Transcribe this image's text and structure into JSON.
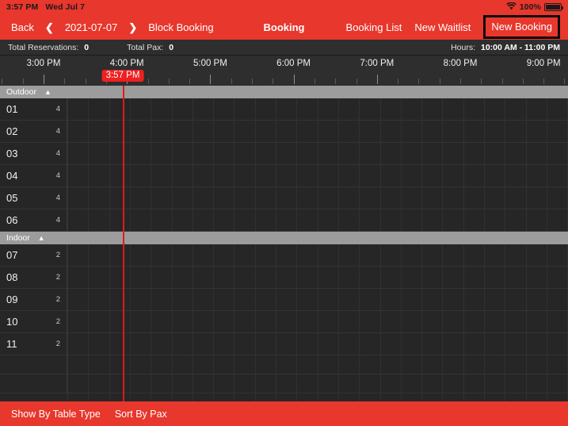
{
  "status_bar": {
    "time": "3:57 PM",
    "date": "Wed Jul 7",
    "battery_percent": "100%",
    "wifi_icon": "wifi-icon",
    "battery_icon": "battery-icon"
  },
  "navbar": {
    "back_label": "Back",
    "prev_icon": "chevron-left-icon",
    "date_label": "2021-07-07",
    "next_icon": "chevron-right-icon",
    "block_booking_label": "Block Booking",
    "title": "Booking",
    "booking_list_label": "Booking List",
    "new_waitlist_label": "New Waitlist",
    "new_booking_label": "New Booking",
    "accent_color": "#e8372c",
    "highlight_border_color": "#0a0a0a"
  },
  "infobar": {
    "total_reservations_label": "Total Reservations:",
    "total_reservations_value": "0",
    "total_pax_label": "Total Pax:",
    "total_pax_value": "0",
    "hours_label": "Hours:",
    "hours_value": "10:00 AM - 11:00 PM"
  },
  "timeline": {
    "hour_labels": [
      "3:00 PM",
      "4:00 PM",
      "5:00 PM",
      "6:00 PM",
      "7:00 PM",
      "8:00 PM",
      "9:00 PM"
    ],
    "current_time_badge": "3:57 PM",
    "current_time_color": "#ef2020"
  },
  "sections": [
    {
      "name": "Outdoor",
      "collapse_icon": "chevron-up-icon",
      "rows": [
        {
          "table": "01",
          "pax": "4"
        },
        {
          "table": "02",
          "pax": "4"
        },
        {
          "table": "03",
          "pax": "4"
        },
        {
          "table": "04",
          "pax": "4"
        },
        {
          "table": "05",
          "pax": "4"
        },
        {
          "table": "06",
          "pax": "4"
        }
      ]
    },
    {
      "name": "Indoor",
      "collapse_icon": "chevron-up-icon",
      "rows": [
        {
          "table": "07",
          "pax": "2"
        },
        {
          "table": "08",
          "pax": "2"
        },
        {
          "table": "09",
          "pax": "2"
        },
        {
          "table": "10",
          "pax": "2"
        },
        {
          "table": "11",
          "pax": "2"
        }
      ]
    }
  ],
  "bottombar": {
    "show_by_table_type_label": "Show By Table Type",
    "sort_by_pax_label": "Sort By Pax"
  }
}
